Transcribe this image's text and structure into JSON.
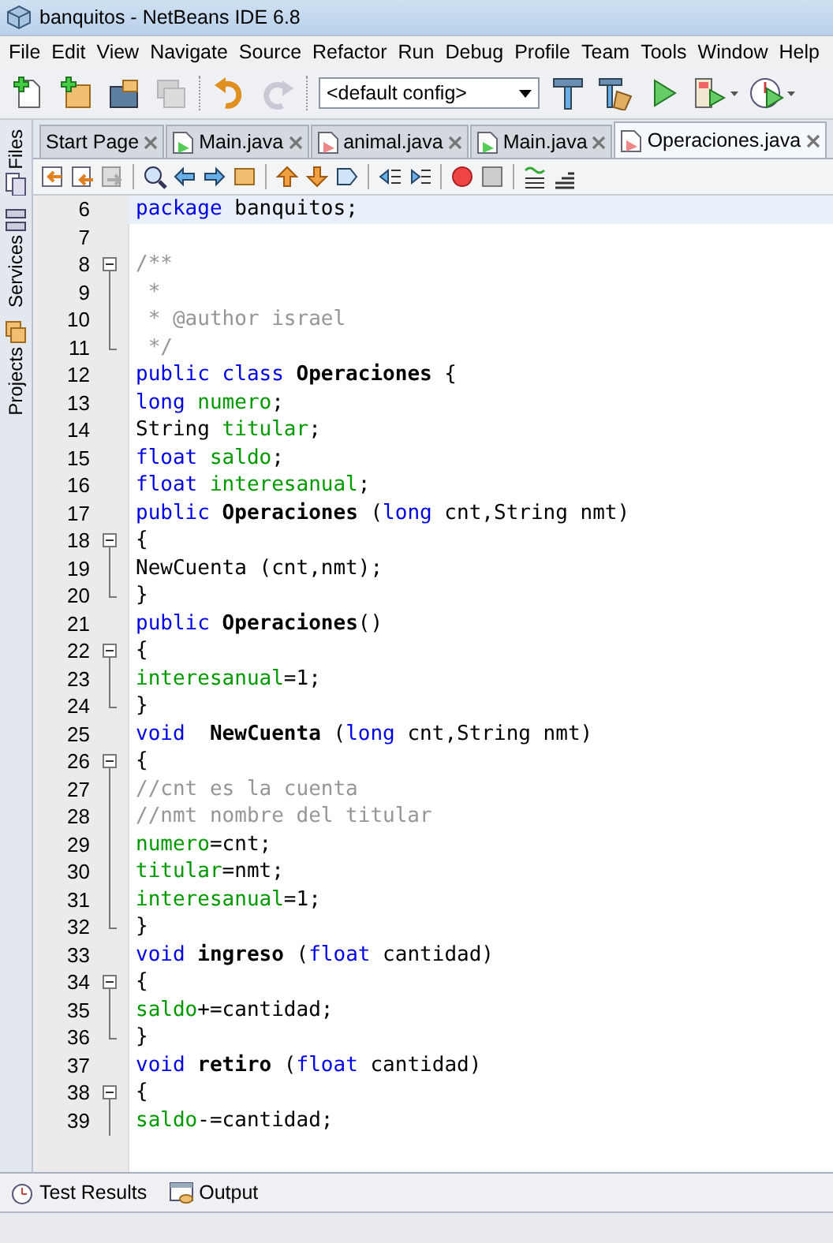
{
  "window": {
    "title": "banquitos - NetBeans IDE 6.8"
  },
  "menu": [
    "File",
    "Edit",
    "View",
    "Navigate",
    "Source",
    "Refactor",
    "Run",
    "Debug",
    "Profile",
    "Team",
    "Tools",
    "Window",
    "Help"
  ],
  "main_toolbar": [
    {
      "disabled": false
    },
    {
      "disabled": false
    },
    {
      "disabled": false
    },
    {
      "disabled": true
    },
    {
      "disabled": false
    },
    {
      "disabled": true
    }
  ],
  "config_dropdown": {
    "value": "<default config>"
  },
  "side_tabs": [
    "Files",
    "Services",
    "Projects"
  ],
  "tabs": [
    {
      "label": "Start Page",
      "selected": false
    },
    {
      "label": "Main.java",
      "selected": false
    },
    {
      "label": "animal.java",
      "selected": false
    },
    {
      "label": "Main.java",
      "selected": false
    },
    {
      "label": "Operaciones.java",
      "selected": true
    }
  ],
  "lines": [
    {
      "number": "6",
      "current": true,
      "kind": "plain",
      "tokens": [
        {
          "kind": "keyword",
          "text": "package"
        },
        {
          "kind": "plain",
          "text": " banquitos;"
        }
      ]
    },
    {
      "number": "7",
      "current": false,
      "kind": "plain"
    },
    {
      "number": "8",
      "current": false,
      "kind": "foldstart",
      "tokens": [
        {
          "kind": "comment",
          "text": "/**"
        }
      ]
    },
    {
      "number": "9",
      "current": false,
      "kind": "foldbody",
      "tokens": [
        {
          "kind": "comment",
          "text": " *"
        }
      ]
    },
    {
      "number": "10",
      "current": false,
      "kind": "foldbody",
      "tokens": [
        {
          "kind": "comment",
          "text": " * @author israel"
        }
      ]
    },
    {
      "number": "11",
      "current": false,
      "kind": "foldend",
      "tokens": [
        {
          "kind": "comment",
          "text": " */"
        }
      ]
    },
    {
      "number": "12",
      "current": false,
      "kind": "plain",
      "tokens": [
        {
          "kind": "keyword",
          "text": "public class "
        },
        {
          "kind": "bold",
          "text": "Operaciones"
        },
        {
          "kind": "plain",
          "text": " {"
        }
      ]
    },
    {
      "number": "13",
      "current": false,
      "kind": "plain",
      "tokens": [
        {
          "kind": "keyword",
          "text": "long "
        },
        {
          "kind": "field",
          "text": "numero"
        },
        {
          "kind": "plain",
          "text": ";"
        }
      ]
    },
    {
      "number": "14",
      "current": false,
      "kind": "plain",
      "tokens": [
        {
          "kind": "plain",
          "text": "String "
        },
        {
          "kind": "field",
          "text": "titular"
        },
        {
          "kind": "plain",
          "text": ";"
        }
      ]
    },
    {
      "number": "15",
      "current": false,
      "kind": "plain",
      "tokens": [
        {
          "kind": "keyword",
          "text": "float "
        },
        {
          "kind": "field",
          "text": "saldo"
        },
        {
          "kind": "plain",
          "text": ";"
        }
      ]
    },
    {
      "number": "16",
      "current": false,
      "kind": "plain",
      "tokens": [
        {
          "kind": "keyword",
          "text": "float "
        },
        {
          "kind": "field",
          "text": "interesanual"
        },
        {
          "kind": "plain",
          "text": ";"
        }
      ]
    },
    {
      "number": "17",
      "current": false,
      "kind": "plain",
      "tokens": [
        {
          "kind": "keyword",
          "text": "public "
        },
        {
          "kind": "bold",
          "text": "Operaciones"
        },
        {
          "kind": "plain",
          "text": " ("
        },
        {
          "kind": "keyword",
          "text": "long"
        },
        {
          "kind": "plain",
          "text": " cnt,String nmt)"
        }
      ]
    },
    {
      "number": "18",
      "current": false,
      "kind": "foldstart",
      "tokens": [
        {
          "kind": "plain",
          "text": "{"
        }
      ]
    },
    {
      "number": "19",
      "current": false,
      "kind": "foldbody",
      "tokens": [
        {
          "kind": "plain",
          "text": "NewCuenta (cnt,nmt);"
        }
      ]
    },
    {
      "number": "20",
      "current": false,
      "kind": "foldend",
      "tokens": [
        {
          "kind": "plain",
          "text": "}"
        }
      ]
    },
    {
      "number": "21",
      "current": false,
      "kind": "plain",
      "tokens": [
        {
          "kind": "keyword",
          "text": "public "
        },
        {
          "kind": "bold",
          "text": "Operaciones"
        },
        {
          "kind": "plain",
          "text": "()"
        }
      ]
    },
    {
      "number": "22",
      "current": false,
      "kind": "foldstart",
      "tokens": [
        {
          "kind": "plain",
          "text": "{"
        }
      ]
    },
    {
      "number": "23",
      "current": false,
      "kind": "foldbody",
      "tokens": [
        {
          "kind": "field",
          "text": "interesanual"
        },
        {
          "kind": "plain",
          "text": "=1;"
        }
      ]
    },
    {
      "number": "24",
      "current": false,
      "kind": "foldend",
      "tokens": [
        {
          "kind": "plain",
          "text": "}"
        }
      ]
    },
    {
      "number": "25",
      "current": false,
      "kind": "plain",
      "tokens": [
        {
          "kind": "keyword",
          "text": "void  "
        },
        {
          "kind": "bold",
          "text": "NewCuenta"
        },
        {
          "kind": "plain",
          "text": " ("
        },
        {
          "kind": "keyword",
          "text": "long"
        },
        {
          "kind": "plain",
          "text": " cnt,String nmt)"
        }
      ]
    },
    {
      "number": "26",
      "current": false,
      "kind": "foldstart",
      "tokens": [
        {
          "kind": "plain",
          "text": "{"
        }
      ]
    },
    {
      "number": "27",
      "current": false,
      "kind": "foldbody",
      "tokens": [
        {
          "kind": "comment",
          "text": "//cnt es la cuenta"
        }
      ]
    },
    {
      "number": "28",
      "current": false,
      "kind": "foldbody",
      "tokens": [
        {
          "kind": "comment",
          "text": "//nmt nombre del titular"
        }
      ]
    },
    {
      "number": "29",
      "current": false,
      "kind": "foldbody",
      "tokens": [
        {
          "kind": "field",
          "text": "numero"
        },
        {
          "kind": "plain",
          "text": "=cnt;"
        }
      ]
    },
    {
      "number": "30",
      "current": false,
      "kind": "foldbody",
      "tokens": [
        {
          "kind": "field",
          "text": "titular"
        },
        {
          "kind": "plain",
          "text": "=nmt;"
        }
      ]
    },
    {
      "number": "31",
      "current": false,
      "kind": "foldbody",
      "tokens": [
        {
          "kind": "field",
          "text": "interesanual"
        },
        {
          "kind": "plain",
          "text": "=1;"
        }
      ]
    },
    {
      "number": "32",
      "current": false,
      "kind": "foldend",
      "tokens": [
        {
          "kind": "plain",
          "text": "}"
        }
      ]
    },
    {
      "number": "33",
      "current": false,
      "kind": "plain",
      "tokens": [
        {
          "kind": "keyword",
          "text": "void "
        },
        {
          "kind": "bold",
          "text": "ingreso"
        },
        {
          "kind": "plain",
          "text": " ("
        },
        {
          "kind": "keyword",
          "text": "float"
        },
        {
          "kind": "plain",
          "text": " cantidad)"
        }
      ]
    },
    {
      "number": "34",
      "current": false,
      "kind": "foldstart",
      "tokens": [
        {
          "kind": "plain",
          "text": "{"
        }
      ]
    },
    {
      "number": "35",
      "current": false,
      "kind": "foldbody",
      "tokens": [
        {
          "kind": "field",
          "text": "saldo"
        },
        {
          "kind": "plain",
          "text": "+=cantidad;"
        }
      ]
    },
    {
      "number": "36",
      "current": false,
      "kind": "foldend",
      "tokens": [
        {
          "kind": "plain",
          "text": "}"
        }
      ]
    },
    {
      "number": "37",
      "current": false,
      "kind": "plain",
      "tokens": [
        {
          "kind": "keyword",
          "text": "void "
        },
        {
          "kind": "bold",
          "text": "retiro"
        },
        {
          "kind": "plain",
          "text": " ("
        },
        {
          "kind": "keyword",
          "text": "float"
        },
        {
          "kind": "plain",
          "text": " cantidad)"
        }
      ]
    },
    {
      "number": "38",
      "current": false,
      "kind": "foldstart",
      "tokens": [
        {
          "kind": "plain",
          "text": "{"
        }
      ]
    },
    {
      "number": "39",
      "current": false,
      "kind": "foldbody",
      "tokens": [
        {
          "kind": "field",
          "text": "saldo"
        },
        {
          "kind": "plain",
          "text": "-=cantidad;"
        }
      ]
    }
  ],
  "bottom_tabs": [
    "Test Results",
    "Output"
  ]
}
